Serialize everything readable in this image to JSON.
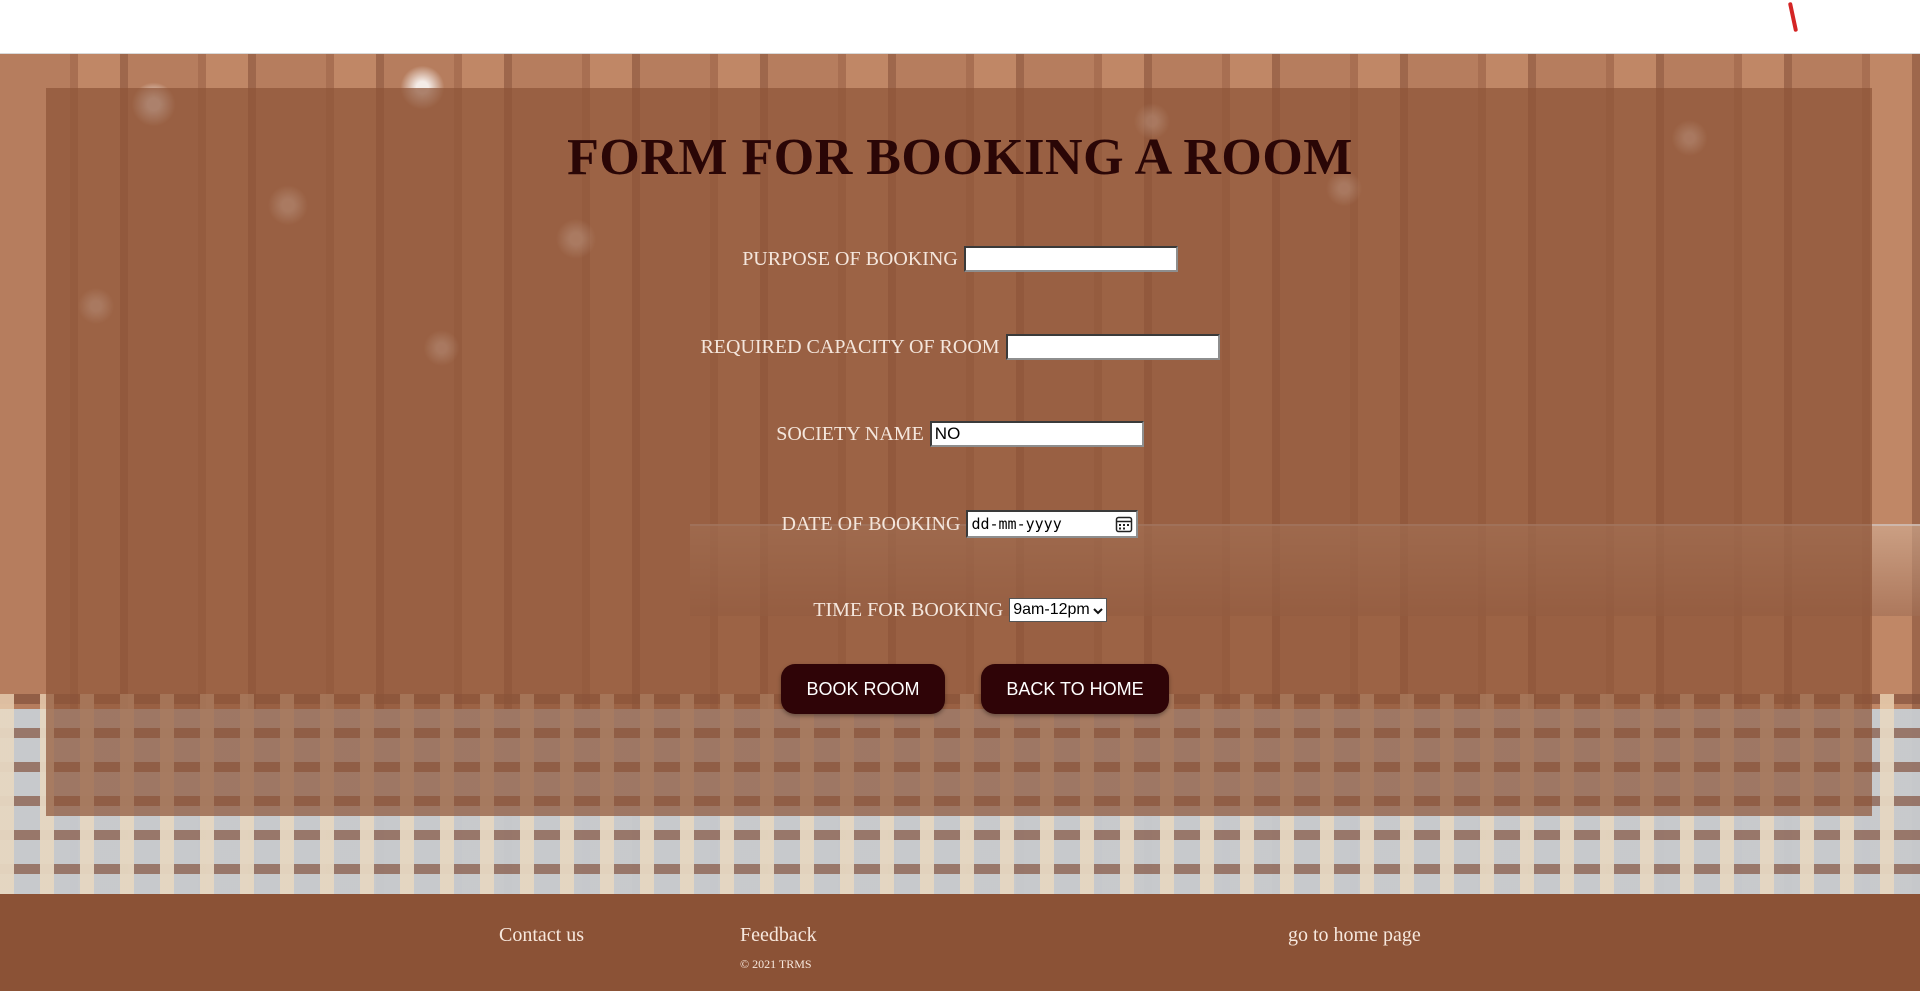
{
  "page": {
    "title": "FORM FOR BOOKING A ROOM"
  },
  "form": {
    "purpose": {
      "label": "PURPOSE OF BOOKING",
      "value": ""
    },
    "capacity": {
      "label": "REQUIRED CAPACITY OF ROOM",
      "value": ""
    },
    "society": {
      "label": "SOCIETY NAME",
      "value": "NO"
    },
    "date": {
      "label": "DATE OF BOOKING",
      "placeholder": "dd-mm-yyyy",
      "icon": "calendar-icon"
    },
    "time": {
      "label": "TIME FOR BOOKING",
      "selected": "9am-12pm",
      "icon": "chevron-down-icon"
    }
  },
  "buttons": {
    "book": "BOOK ROOM",
    "back": "BACK TO HOME"
  },
  "footer": {
    "contact": "Contact us",
    "feedback": "Feedback",
    "copyright": "© 2021 TRMS",
    "home": "go to home page"
  },
  "colors": {
    "overlay": "#8d5438",
    "title": "#2a0606",
    "button": "#2f0407",
    "footer": "#8b5236",
    "label": "#f4e6dc"
  }
}
